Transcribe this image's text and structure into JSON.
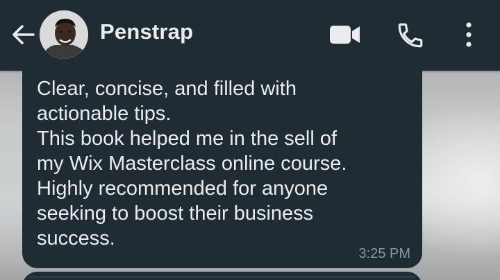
{
  "header": {
    "contact_name": "Penstrap",
    "icons": {
      "back": "arrow-left-icon",
      "video": "video-camera-icon",
      "call": "phone-icon",
      "menu": "more-vertical-icon"
    }
  },
  "message": {
    "text": "Clear, concise, and filled with\nactionable tips.\nThis book helped me in the sell of\nmy Wix Masterclass online course.\nHighly recommended for anyone\nseeking to boost their business\nsuccess.",
    "time": "3:25 PM"
  },
  "colors": {
    "app_bar": "#202c33",
    "bubble": "#202c33",
    "text": "#e9edef",
    "timestamp": "#8696a0"
  }
}
